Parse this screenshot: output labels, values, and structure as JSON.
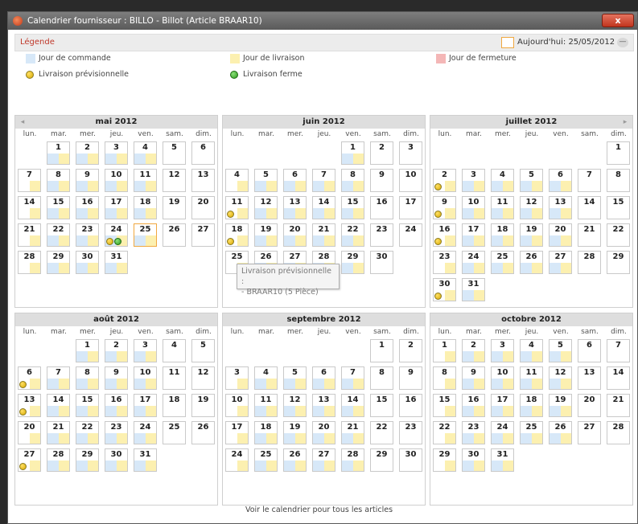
{
  "window": {
    "title": "Calendrier fournisseur : BILLO - Billot (Article BRAAR10)",
    "close_label": "x"
  },
  "legend": {
    "title": "Légende",
    "today_label": "Aujourd'hui: 25/05/2012",
    "collapse_icon": "chevron-up-icon",
    "items": {
      "order_day": "Jour de commande",
      "delivery_day": "Jour de livraison",
      "closing_day": "Jour de fermeture",
      "forecast_delivery": "Livraison prévisionnelle",
      "firm_delivery": "Livraison ferme"
    },
    "colors": {
      "order_day": "#d7e8f8",
      "delivery_day": "#fcf0b0",
      "closing_day": "#f4b7b7",
      "forecast_dot": "#e6c21e",
      "firm_dot": "#3aa82a",
      "today_border": "#f0a840"
    }
  },
  "weekday_names": [
    "lun.",
    "mar.",
    "mer.",
    "jeu.",
    "ven.",
    "sam.",
    "dim."
  ],
  "months": [
    {
      "name": "mai 2012",
      "offset": 1,
      "days": 31,
      "forecast": [
        24
      ],
      "firm": [
        24
      ],
      "today": 25
    },
    {
      "name": "juin 2012",
      "offset": 4,
      "days": 30,
      "forecast": [
        11,
        18
      ],
      "firm": [],
      "today": null
    },
    {
      "name": "juillet 2012",
      "offset": 6,
      "days": 31,
      "forecast": [
        2,
        9,
        16,
        30
      ],
      "firm": [],
      "today": null
    },
    {
      "name": "août 2012",
      "offset": 2,
      "days": 31,
      "forecast": [
        6,
        13,
        27
      ],
      "firm": [],
      "today": null
    },
    {
      "name": "septembre 2012",
      "offset": 5,
      "days": 30,
      "forecast": [],
      "firm": [],
      "today": null
    },
    {
      "name": "octobre 2012",
      "offset": 0,
      "days": 31,
      "forecast": [],
      "firm": [],
      "today": null
    }
  ],
  "tooltip": {
    "line1": "Livraison prévisionnelle :",
    "line2": "- BRAAR10 (5 Pièce)"
  },
  "footer_link": "Voir le calendrier pour tous les articles"
}
